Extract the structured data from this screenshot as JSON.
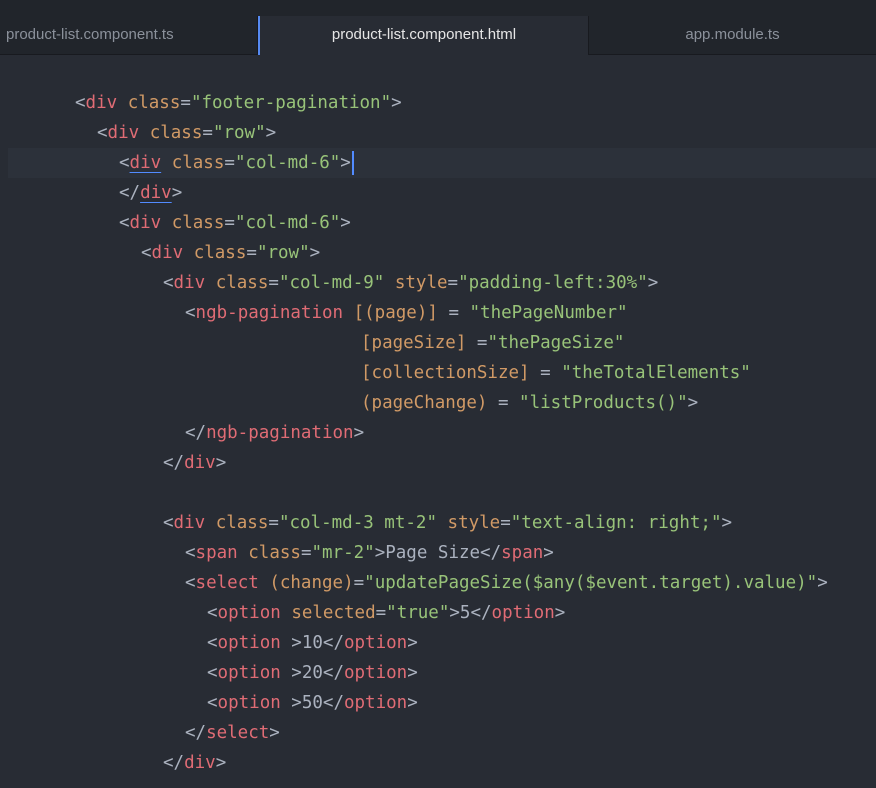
{
  "tabs": [
    {
      "label": "product-list.component.ts"
    },
    {
      "label": "product-list.component.html"
    },
    {
      "label": "app.module.ts"
    }
  ],
  "active_tab": 1,
  "lines": [
    [
      [
        "p",
        "<"
      ],
      [
        "t",
        "div"
      ],
      [
        "p",
        " "
      ],
      [
        "a",
        "class"
      ],
      [
        "p",
        "="
      ],
      [
        "s",
        "\"footer-pagination\""
      ],
      [
        "p",
        ">"
      ]
    ],
    [
      [
        "p",
        "<"
      ],
      [
        "t",
        "div"
      ],
      [
        "p",
        " "
      ],
      [
        "a",
        "class"
      ],
      [
        "p",
        "="
      ],
      [
        "s",
        "\"row\""
      ],
      [
        "p",
        ">"
      ]
    ],
    [
      [
        "p",
        "<"
      ],
      [
        "t",
        "div",
        "u"
      ],
      [
        "p",
        " "
      ],
      [
        "a",
        "class"
      ],
      [
        "p",
        "="
      ],
      [
        "s",
        "\"col-md-6\""
      ],
      [
        "p",
        ">"
      ],
      [
        "cursor",
        ""
      ]
    ],
    [
      [
        "p",
        "</"
      ],
      [
        "t",
        "div",
        "u"
      ],
      [
        "p",
        ">"
      ]
    ],
    [
      [
        "p",
        "<"
      ],
      [
        "t",
        "div"
      ],
      [
        "p",
        " "
      ],
      [
        "a",
        "class"
      ],
      [
        "p",
        "="
      ],
      [
        "s",
        "\"col-md-6\""
      ],
      [
        "p",
        ">"
      ]
    ],
    [
      [
        "p",
        "<"
      ],
      [
        "t",
        "div"
      ],
      [
        "p",
        " "
      ],
      [
        "a",
        "class"
      ],
      [
        "p",
        "="
      ],
      [
        "s",
        "\"row\""
      ],
      [
        "p",
        ">"
      ]
    ],
    [
      [
        "p",
        "<"
      ],
      [
        "t",
        "div"
      ],
      [
        "p",
        " "
      ],
      [
        "a",
        "class"
      ],
      [
        "p",
        "="
      ],
      [
        "s",
        "\"col-md-9\""
      ],
      [
        "p",
        " "
      ],
      [
        "a",
        "style"
      ],
      [
        "p",
        "="
      ],
      [
        "s",
        "\"padding-left:30%\""
      ],
      [
        "p",
        ">"
      ]
    ],
    [
      [
        "p",
        "<"
      ],
      [
        "t",
        "ngb-pagination"
      ],
      [
        "p",
        " "
      ],
      [
        "a",
        "[(page)]"
      ],
      [
        "p",
        " = "
      ],
      [
        "s",
        "\"thePageNumber\""
      ]
    ],
    [
      [
        "a",
        "[pageSize]"
      ],
      [
        "p",
        " ="
      ],
      [
        "s",
        "\"thePageSize\""
      ]
    ],
    [
      [
        "a",
        "[collectionSize]"
      ],
      [
        "p",
        " = "
      ],
      [
        "s",
        "\"theTotalElements\""
      ]
    ],
    [
      [
        "a",
        "(pageChange)"
      ],
      [
        "p",
        " = "
      ],
      [
        "s",
        "\"listProducts()\""
      ],
      [
        "p",
        ">"
      ]
    ],
    [
      [
        "p",
        "</"
      ],
      [
        "t",
        "ngb-pagination"
      ],
      [
        "p",
        ">"
      ]
    ],
    [
      [
        "p",
        "</"
      ],
      [
        "t",
        "div"
      ],
      [
        "p",
        ">"
      ]
    ],
    [],
    [
      [
        "p",
        "<"
      ],
      [
        "t",
        "div"
      ],
      [
        "p",
        " "
      ],
      [
        "a",
        "class"
      ],
      [
        "p",
        "="
      ],
      [
        "s",
        "\"col-md-3 mt-2\""
      ],
      [
        "p",
        " "
      ],
      [
        "a",
        "style"
      ],
      [
        "p",
        "="
      ],
      [
        "s",
        "\"text-align: right;\""
      ],
      [
        "p",
        ">"
      ]
    ],
    [
      [
        "p",
        "<"
      ],
      [
        "t",
        "span"
      ],
      [
        "p",
        " "
      ],
      [
        "a",
        "class"
      ],
      [
        "p",
        "="
      ],
      [
        "s",
        "\"mr-2\""
      ],
      [
        "p",
        ">Page Size</"
      ],
      [
        "t",
        "span"
      ],
      [
        "p",
        ">"
      ]
    ],
    [
      [
        "p",
        "<"
      ],
      [
        "t",
        "select"
      ],
      [
        "p",
        " "
      ],
      [
        "a",
        "(change)"
      ],
      [
        "p",
        "="
      ],
      [
        "s",
        "\"updatePageSize($any($event.target).value)\""
      ],
      [
        "p",
        ">"
      ]
    ],
    [
      [
        "p",
        "<"
      ],
      [
        "t",
        "option"
      ],
      [
        "p",
        " "
      ],
      [
        "a",
        "selected"
      ],
      [
        "p",
        "="
      ],
      [
        "s",
        "\"true\""
      ],
      [
        "p",
        ">5</"
      ],
      [
        "t",
        "option"
      ],
      [
        "p",
        ">"
      ]
    ],
    [
      [
        "p",
        "<"
      ],
      [
        "t",
        "option"
      ],
      [
        "p",
        " >10</"
      ],
      [
        "t",
        "option"
      ],
      [
        "p",
        ">"
      ]
    ],
    [
      [
        "p",
        "<"
      ],
      [
        "t",
        "option"
      ],
      [
        "p",
        " >20</"
      ],
      [
        "t",
        "option"
      ],
      [
        "p",
        ">"
      ]
    ],
    [
      [
        "p",
        "<"
      ],
      [
        "t",
        "option"
      ],
      [
        "p",
        " >50</"
      ],
      [
        "t",
        "option"
      ],
      [
        "p",
        ">"
      ]
    ],
    [
      [
        "p",
        "</"
      ],
      [
        "t",
        "select"
      ],
      [
        "p",
        ">"
      ]
    ],
    [
      [
        "p",
        "</"
      ],
      [
        "t",
        "div"
      ],
      [
        "p",
        ">"
      ]
    ]
  ]
}
